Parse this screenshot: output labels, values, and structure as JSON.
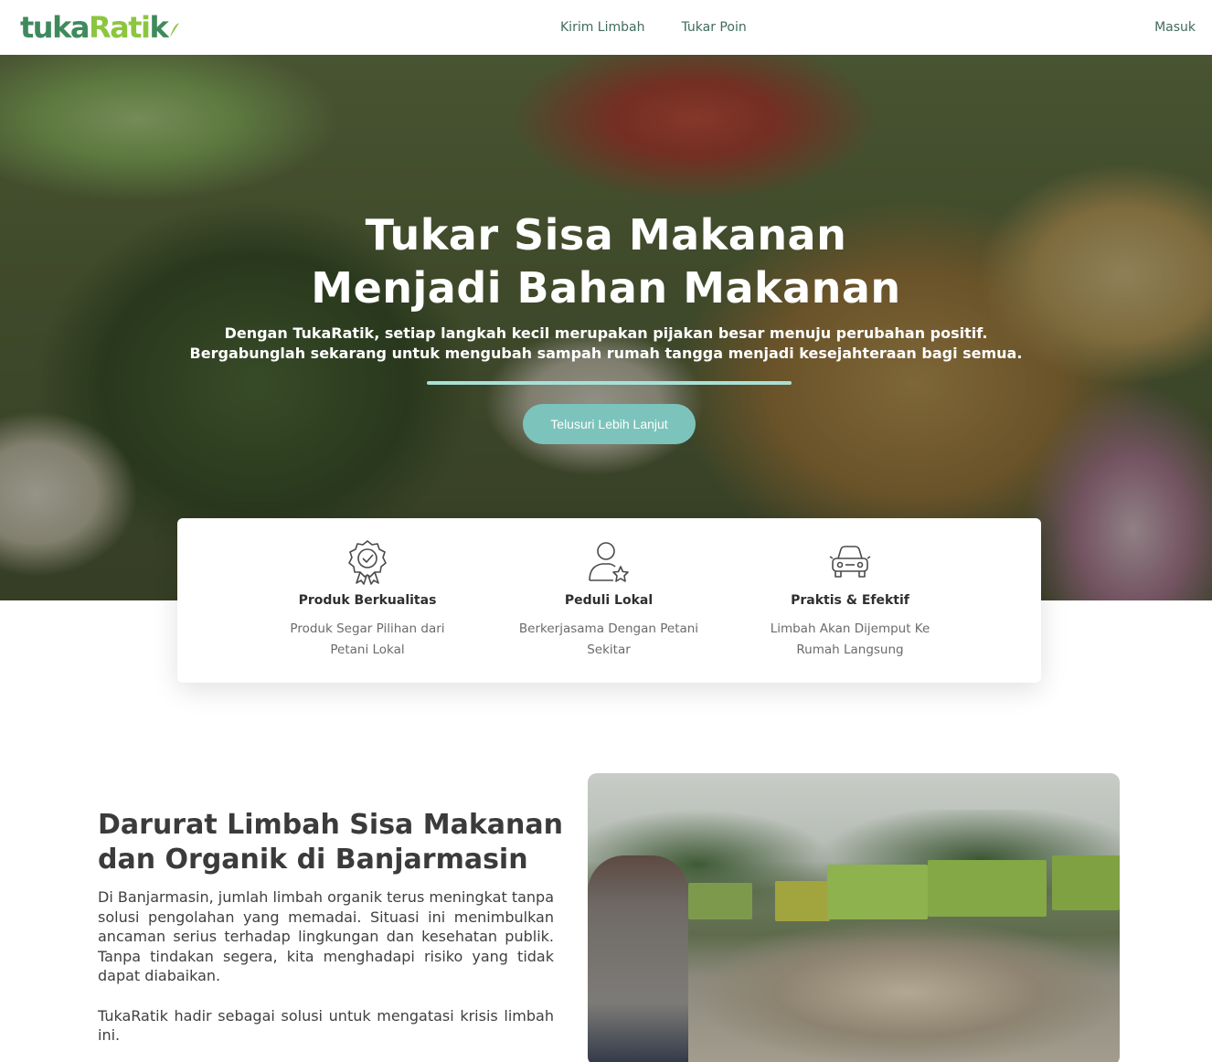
{
  "brand": {
    "logo_part1": "tuka",
    "logo_part2": "Rati",
    "logo_part3": "k"
  },
  "nav": {
    "links": [
      {
        "label": "Kirim Limbah"
      },
      {
        "label": "Tukar Poin"
      }
    ],
    "login_label": "Masuk"
  },
  "hero": {
    "title_line1": "Tukar Sisa Makanan",
    "title_line2": "Menjadi Bahan Makanan",
    "subtitle_line1": "Dengan TukaRatik, setiap langkah kecil merupakan pijakan besar menuju perubahan positif.",
    "subtitle_line2": "Bergabunglah sekarang untuk mengubah sampah rumah tangga menjadi kesejahteraan bagi semua.",
    "cta_label": "Telusuri Lebih Lanjut"
  },
  "features": [
    {
      "icon": "certificate-badge-icon",
      "title": "Produk Berkualitas",
      "desc_line1": "Produk Segar Pilihan dari",
      "desc_line2": "Petani Lokal"
    },
    {
      "icon": "user-star-icon",
      "title": "Peduli Lokal",
      "desc_line1": "Berkerjasama Dengan Petani",
      "desc_line2": "Sekitar"
    },
    {
      "icon": "car-icon",
      "title": "Praktis & Efektif",
      "desc_line1": "Limbah Akan Dijemput Ke",
      "desc_line2": "Rumah Langsung"
    }
  ],
  "section": {
    "title_line1": "Darurat Limbah Sisa Makanan",
    "title_line2": "dan Organik di Banjarmasin",
    "paragraph1": "Di Banjarmasin, jumlah limbah organik terus meningkat tanpa solusi pengolahan yang memadai. Situasi ini menimbulkan ancaman serius terhadap lingkungan dan kesehatan publik. Tanpa tindakan segera, kita menghadapi risiko yang tidak dapat diabaikan.",
    "paragraph2": "TukaRatik hadir sebagai solusi untuk mengatasi krisis limbah ini."
  },
  "colors": {
    "brand_green": "#3f8a5c",
    "brand_lime": "#8cc63f",
    "accent_teal": "#7cc3bb",
    "divider": "#a8e0d6"
  }
}
